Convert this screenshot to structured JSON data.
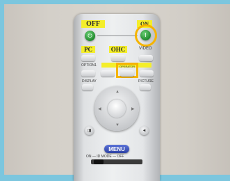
{
  "remote": {
    "off_label": "OFF",
    "on_label": "ON",
    "power_symbol": "I",
    "pc_label": "PC",
    "ohc_label": "OHC",
    "option_label": "OPTION1",
    "operator_label": "OPERATOR",
    "display_label": "DISPLAY",
    "picture_label": "PICTURE",
    "menu_label": "MENU",
    "id_mode_label": "ON — ID MODE — OFF"
  },
  "colors": {
    "highlight_yellow": "#f4ee2a",
    "highlight_ring": "#f5b400",
    "power_green": "#1f8a2c",
    "menu_blue": "#2c41a4"
  }
}
